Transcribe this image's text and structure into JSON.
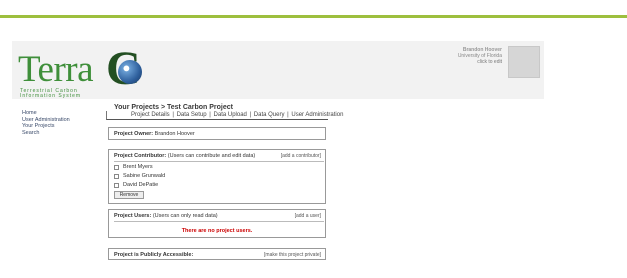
{
  "header": {
    "logo_word": "Terra",
    "logo_letter": "C",
    "logo_subtitle": "Terrestrial Carbon Information System",
    "user_name": "Brandon Hoover",
    "user_org": "University of Florida",
    "user_edit": "click to edit"
  },
  "sidenav": {
    "items": [
      {
        "label": "Home"
      },
      {
        "label": "User Administration"
      },
      {
        "label": "Your Projects"
      },
      {
        "label": "Search"
      }
    ]
  },
  "breadcrumb": {
    "root": "Your Projects",
    "separator": ">",
    "current": "Test Carbon Project"
  },
  "submenu": {
    "items": [
      {
        "label": "Project Details"
      },
      {
        "label": "Data Setup"
      },
      {
        "label": "Data Upload"
      },
      {
        "label": "Data Query"
      },
      {
        "label": "User Administration"
      }
    ],
    "separator": "|"
  },
  "owner": {
    "label": "Project Owner:",
    "value": "Brandon Hoover"
  },
  "contributors": {
    "label": "Project Contributor:",
    "note": "(Users can contribute and edit data)",
    "add_link": "[add a contributor]",
    "people": [
      {
        "name": "Brent Myers"
      },
      {
        "name": "Sabine Grunwald"
      },
      {
        "name": "David DePatie"
      }
    ],
    "remove_label": "Remove"
  },
  "users": {
    "label": "Project Users:",
    "note": "(Users can only read data)",
    "add_link": "[add a user]",
    "empty_message": "There are no project users."
  },
  "public": {
    "label": "Project is Publicly Accessible:",
    "link": "[make this project private]"
  },
  "colors": {
    "accent_green": "#9dbf3e",
    "logo_green": "#3f8f3a",
    "warning_red": "#cc0000"
  }
}
